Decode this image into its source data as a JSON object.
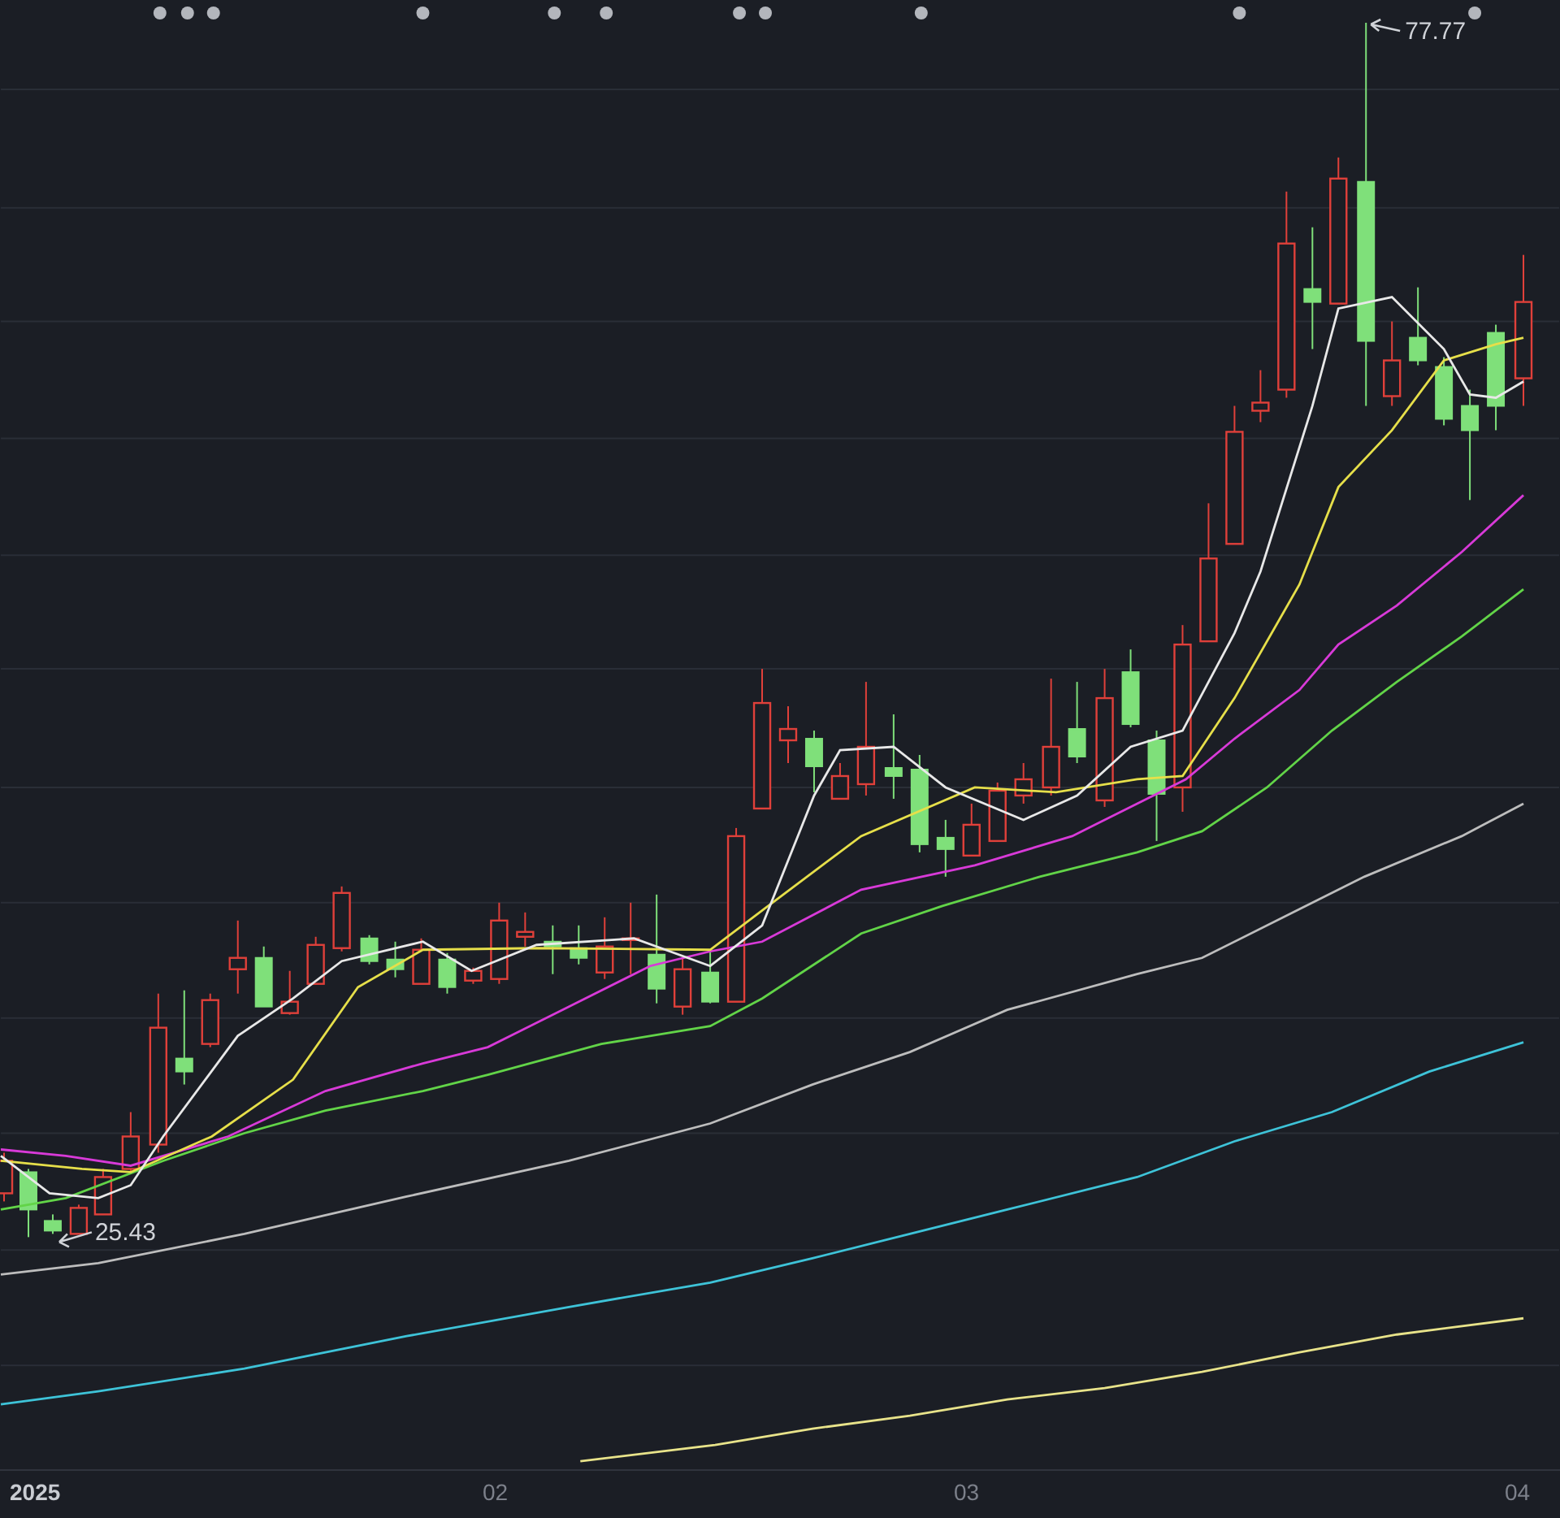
{
  "chart": {
    "annotations": [
      {
        "label": "77.77",
        "kind": "high"
      },
      {
        "label": "25.43",
        "kind": "low"
      }
    ],
    "x_labels": [
      {
        "label": "2025",
        "emphasis": true
      },
      {
        "label": "02",
        "emphasis": false
      },
      {
        "label": "03",
        "emphasis": false
      },
      {
        "label": "04",
        "emphasis": false
      }
    ]
  }
}
